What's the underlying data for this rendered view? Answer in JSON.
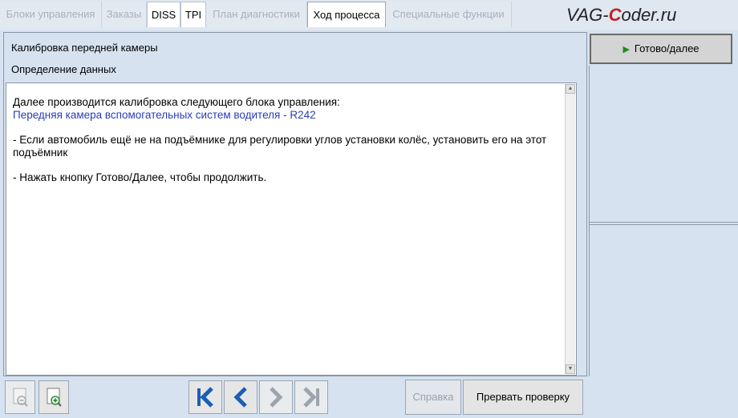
{
  "tabs": [
    {
      "label": "Блоки управления",
      "state": "disabled"
    },
    {
      "label": "Заказы",
      "state": "disabled"
    },
    {
      "label": "DISS",
      "state": "enabled"
    },
    {
      "label": "TPI",
      "state": "enabled"
    },
    {
      "label": "План диагностики",
      "state": "disabled"
    },
    {
      "label": "Ход процесса",
      "state": "active"
    },
    {
      "label": "Специальные функции",
      "state": "disabled"
    }
  ],
  "logo": {
    "prefix": "VAG-",
    "c": "C",
    "suffix": "oder.ru"
  },
  "header": {
    "title": "Калибровка передней камеры",
    "subtitle": "Определение данных"
  },
  "content": {
    "line1": "Далее производится калибровка следующего блока управления:",
    "line2": "Передняя камера вспомогательных систем водителя - R242",
    "line3": "- Если автомобиль ещё не на подъёмнике для регулировки углов установки колёс, установить его на этот подъёмник",
    "line4": "- Нажать кнопку Готово/Далее, чтобы продолжить."
  },
  "right": {
    "ready_label": "Готово/далее"
  },
  "bottom": {
    "help_label": "Справка",
    "abort_label": "Прервать проверку"
  },
  "colors": {
    "link": "#2a3cb8",
    "play": "#1f8a1f",
    "nav_active": "#1a5fb4",
    "nav_disabled": "#9da4ad",
    "logo_accent": "#c81d1d"
  }
}
